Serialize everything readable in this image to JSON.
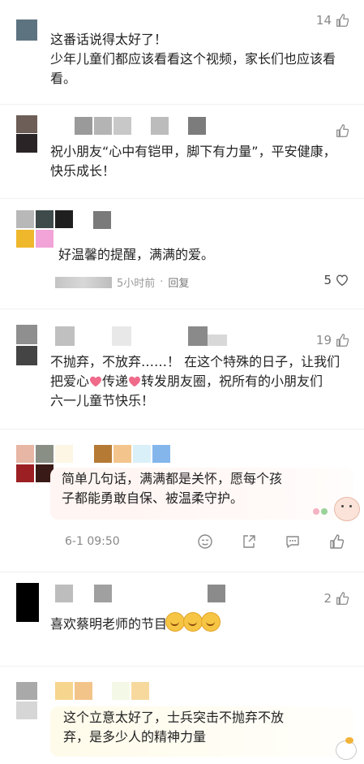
{
  "comments": [
    {
      "lines": [
        "这番话说得太好了！",
        "少年儿童们都应该看看这个视频，家长们也应该看",
        "看。"
      ],
      "likes": "14"
    },
    {
      "lines": [
        "祝小朋友“心中有铠甲，脚下有力量”，平安健康，",
        "快乐成长！"
      ],
      "likes": ""
    },
    {
      "lines": [
        "好温馨的提醒，满满的爱。"
      ],
      "time": "5小时前",
      "dot": "·",
      "reply": "回复",
      "likes": "5"
    },
    {
      "lines": [
        "不抛弃，不放弃……！ 在这个特殊的日子，让我们",
        "把爱心",
        "传递",
        "转发朋友圈，祝所有的小朋友们",
        "六一儿童节快乐！"
      ],
      "likes": "19"
    },
    {
      "lines": [
        "简单几句话，满满都是关怀，愿每个孩",
        "子都能勇敢自保、被温柔守护。"
      ],
      "time": "6-1 09:50"
    },
    {
      "lines": [
        "喜欢蔡明老师的节目"
      ],
      "likes": "2"
    },
    {
      "lines": [
        "这个立意太好了，士兵突击不抛弃不放",
        "弃，是多少人的精神力量"
      ]
    }
  ],
  "icons": {
    "like": "thumb-up-icon",
    "heart": "heart-outline-icon",
    "emoji": "face-icon",
    "share": "share-icon",
    "comment": "comment-icon"
  },
  "colors": {
    "meta": "#999999",
    "heart_emoji": "#f06a8a"
  }
}
